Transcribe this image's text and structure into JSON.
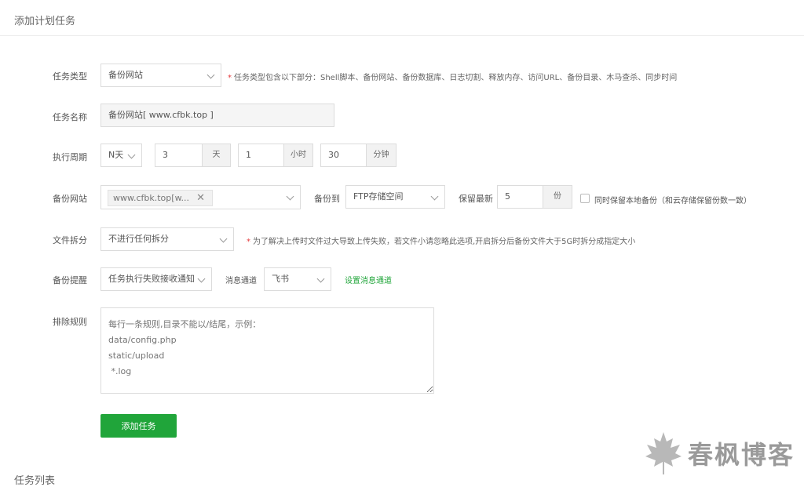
{
  "page": {
    "title": "添加计划任务",
    "next_section_title": "任务列表"
  },
  "form": {
    "task_type": {
      "label": "任务类型",
      "value": "备份网站",
      "hint": "任务类型包含以下部分：Shell脚本、备份网站、备份数据库、日志切割、释放内存、访问URL、备份目录、木马查杀、同步时间"
    },
    "task_name": {
      "label": "任务名称",
      "value": "备份网站[ www.cfbk.top ]"
    },
    "cycle": {
      "label": "执行周期",
      "mode": "N天",
      "days": "3",
      "days_unit": "天",
      "hours": "1",
      "hours_unit": "小时",
      "minutes": "30",
      "minutes_unit": "分钟"
    },
    "backup_site": {
      "label": "备份网站",
      "selected_tag": "www.cfbk.top[w...",
      "backup_to_label": "备份到",
      "backup_to_value": "FTP存储空间",
      "keep_label": "保留最新",
      "keep_value": "5",
      "keep_unit": "份",
      "local_backup_label": "同时保留本地备份（和云存储保留份数一致）",
      "local_backup_checked": false
    },
    "file_split": {
      "label": "文件拆分",
      "value": "不进行任何拆分",
      "hint": "为了解决上传时文件过大导致上传失败，若文件小请忽略此选项,开启拆分后备份文件大于5G时拆分成指定大小"
    },
    "notify": {
      "label": "备份提醒",
      "value": "任务执行失败接收通知",
      "channel_label": "消息通道",
      "channel_value": "飞书",
      "setup_link": "设置消息通道"
    },
    "exclude": {
      "label": "排除规则",
      "placeholder": "每行一条规则,目录不能以/结尾，示例：\ndata/config.php\nstatic/upload\n *.log"
    },
    "submit_label": "添加任务"
  },
  "watermark": {
    "text": "春枫博客",
    "icon": "maple-leaf-icon"
  },
  "colors": {
    "accent": "#20a53a",
    "required": "#e4393c",
    "border": "#dcdcdc"
  }
}
